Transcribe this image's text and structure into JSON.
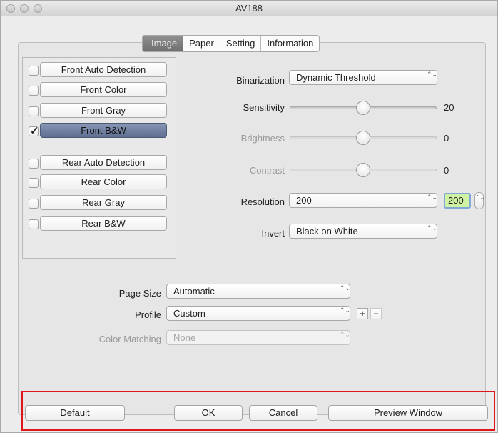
{
  "window": {
    "title": "AV188"
  },
  "tabs": [
    {
      "label": "Image",
      "selected": true
    },
    {
      "label": "Paper",
      "selected": false
    },
    {
      "label": "Setting",
      "selected": false
    },
    {
      "label": "Information",
      "selected": false
    }
  ],
  "image_types": [
    {
      "label": "Front Auto Detection",
      "checked": false
    },
    {
      "label": "Front Color",
      "checked": false
    },
    {
      "label": "Front Gray",
      "checked": false
    },
    {
      "label": "Front B&W",
      "checked": true,
      "check_glyph": "✓"
    },
    {
      "label": "Rear Auto Detection",
      "checked": false
    },
    {
      "label": "Rear Color",
      "checked": false
    },
    {
      "label": "Rear Gray",
      "checked": false
    },
    {
      "label": "Rear B&W",
      "checked": false
    }
  ],
  "binarization": {
    "label": "Binarization",
    "value": "Dynamic Threshold"
  },
  "sensitivity": {
    "label": "Sensitivity",
    "value": "20",
    "level": 0.5
  },
  "brightness": {
    "label": "Brightness",
    "value": "0",
    "level": 0.5
  },
  "contrast": {
    "label": "Contrast",
    "value": "0",
    "level": 0.5
  },
  "resolution": {
    "label": "Resolution",
    "value": "200",
    "field_value": "200"
  },
  "invert": {
    "label": "Invert",
    "value": "Black on White"
  },
  "page_size": {
    "label": "Page Size",
    "value": "Automatic"
  },
  "profile": {
    "label": "Profile",
    "value": "Custom",
    "add": "+",
    "remove": "−"
  },
  "color_matching": {
    "label": "Color Matching",
    "value": "None"
  },
  "popup_arrows": "⌃⌄",
  "buttons": {
    "default": "Default",
    "ok": "OK",
    "cancel": "Cancel",
    "preview": "Preview Window"
  },
  "colors": {
    "highlight": "#e0151b",
    "resolution_field": "#cff2a3"
  }
}
